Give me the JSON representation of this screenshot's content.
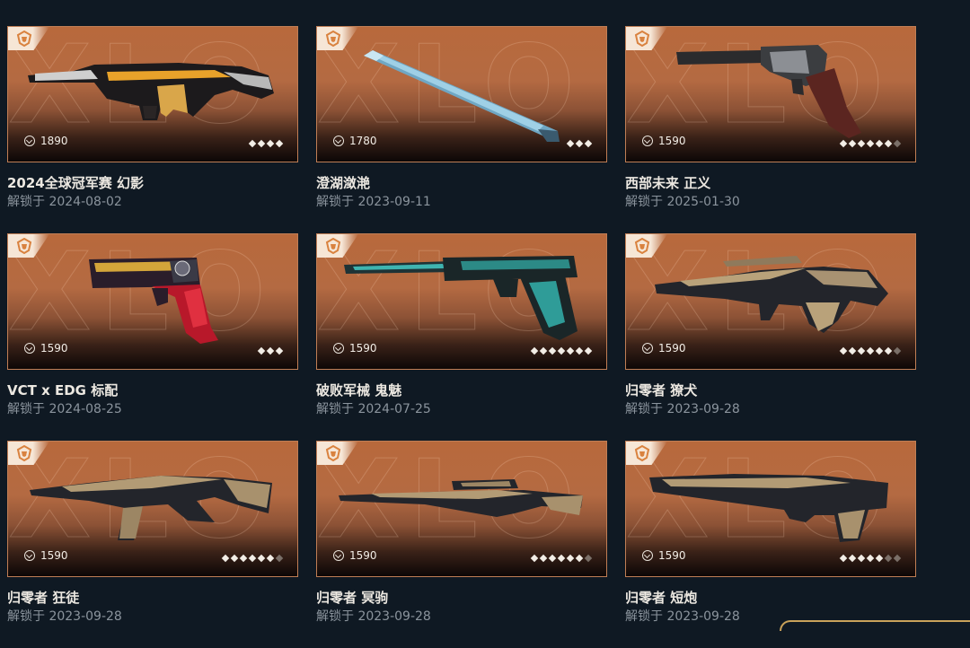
{
  "colors": {
    "background": "#0f1923",
    "card_border": "#c07e55",
    "title_text": "#ece8e1",
    "unlock_text": "#8b949d"
  },
  "items": [
    {
      "title": "2024全球冠军赛 幻影",
      "unlock": "解锁于 2024-08-02",
      "price": "1890",
      "tier_level": 4,
      "tier_max": 4,
      "weapon_icon": "phantom-rifle-icon"
    },
    {
      "title": "澄湖潋滟",
      "unlock": "解锁于 2023-09-11",
      "price": "1780",
      "tier_level": 3,
      "tier_max": 3,
      "weapon_icon": "melee-knife-icon"
    },
    {
      "title": "西部未来 正义",
      "unlock": "解锁于 2025-01-30",
      "price": "1590",
      "tier_level": 6,
      "tier_max": 7,
      "weapon_icon": "sheriff-revolver-icon"
    },
    {
      "title": "VCT x EDG 标配",
      "unlock": "解锁于 2024-08-25",
      "price": "1590",
      "tier_level": 3,
      "tier_max": 3,
      "weapon_icon": "classic-pistol-icon"
    },
    {
      "title": "破败军械 鬼魅",
      "unlock": "解锁于 2024-07-25",
      "price": "1590",
      "tier_level": 7,
      "tier_max": 7,
      "weapon_icon": "ghost-pistol-icon"
    },
    {
      "title": "归零者 獠犬",
      "unlock": "解锁于 2023-09-28",
      "price": "1590",
      "tier_level": 6,
      "tier_max": 7,
      "weapon_icon": "bulldog-rifle-icon"
    },
    {
      "title": "归零者 狂徒",
      "unlock": "解锁于 2023-09-28",
      "price": "1590",
      "tier_level": 6,
      "tier_max": 7,
      "weapon_icon": "vandal-rifle-icon"
    },
    {
      "title": "归零者 冥驹",
      "unlock": "解锁于 2023-09-28",
      "price": "1590",
      "tier_level": 6,
      "tier_max": 7,
      "weapon_icon": "marshal-sniper-icon"
    },
    {
      "title": "归零者 短炮",
      "unlock": "解锁于 2023-09-28",
      "price": "1590",
      "tier_level": 5,
      "tier_max": 7,
      "weapon_icon": "bucky-shotgun-icon"
    }
  ]
}
